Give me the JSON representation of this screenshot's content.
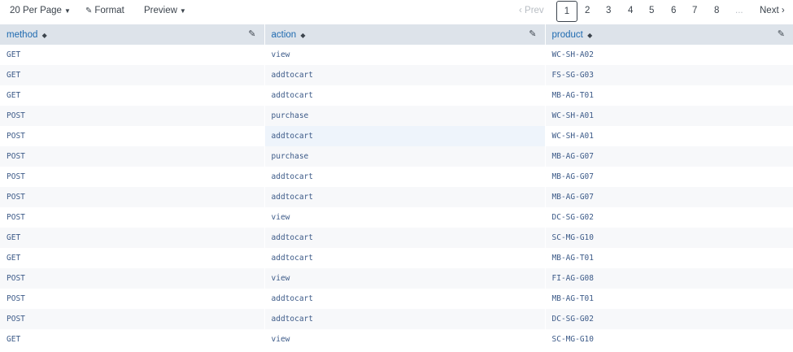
{
  "toolbar": {
    "per_page_label": "20 Per Page",
    "format_label": "Format",
    "preview_label": "Preview"
  },
  "pager": {
    "prev_label": "Prev",
    "pages": [
      "1",
      "2",
      "3",
      "4",
      "5",
      "6",
      "7",
      "8"
    ],
    "ellipsis": "...",
    "next_label": "Next",
    "current_page": "1"
  },
  "table": {
    "columns": [
      "method",
      "action",
      "product"
    ],
    "rows": [
      [
        "GET",
        "view",
        "WC-SH-A02"
      ],
      [
        "GET",
        "addtocart",
        "FS-SG-G03"
      ],
      [
        "GET",
        "addtocart",
        "MB-AG-T01"
      ],
      [
        "POST",
        "purchase",
        "WC-SH-A01"
      ],
      [
        "POST",
        "addtocart",
        "WC-SH-A01"
      ],
      [
        "POST",
        "purchase",
        "MB-AG-G07"
      ],
      [
        "POST",
        "addtocart",
        "MB-AG-G07"
      ],
      [
        "POST",
        "addtocart",
        "MB-AG-G07"
      ],
      [
        "POST",
        "view",
        "DC-SG-G02"
      ],
      [
        "GET",
        "addtocart",
        "SC-MG-G10"
      ],
      [
        "GET",
        "addtocart",
        "MB-AG-T01"
      ],
      [
        "POST",
        "view",
        "FI-AG-G08"
      ],
      [
        "POST",
        "addtocart",
        "MB-AG-T01"
      ],
      [
        "POST",
        "addtocart",
        "DC-SG-G02"
      ],
      [
        "GET",
        "view",
        "SC-MG-G10"
      ]
    ]
  }
}
